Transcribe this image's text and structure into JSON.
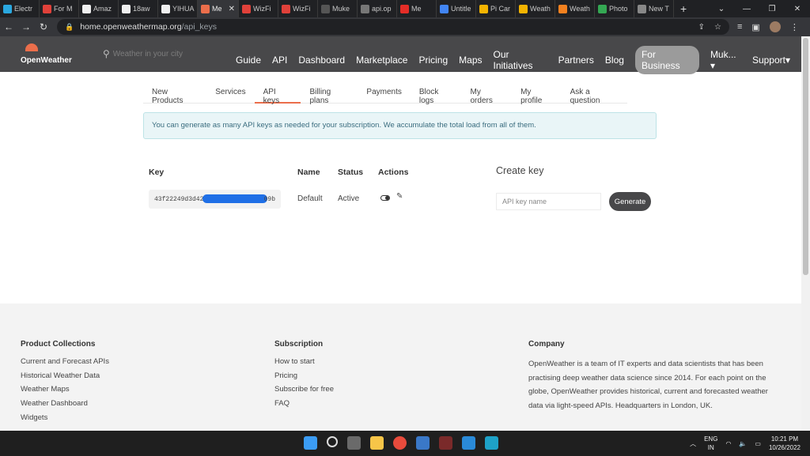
{
  "browser": {
    "tabs": [
      {
        "label": "Electr",
        "color": "#2aa8e0"
      },
      {
        "label": "For M",
        "color": "#e0413a"
      },
      {
        "label": "Amaz",
        "color": "#f0f0f0"
      },
      {
        "label": "18aw",
        "color": "#f0f0f0"
      },
      {
        "label": "YIHUA",
        "color": "#f0f0f0"
      },
      {
        "label": "Me",
        "color": "#eb6e4b",
        "active": true
      },
      {
        "label": "WizFi",
        "color": "#e0413a"
      },
      {
        "label": "WizFi",
        "color": "#e0413a"
      },
      {
        "label": "Muke",
        "color": "#555555"
      },
      {
        "label": "api.op",
        "color": "#777777"
      },
      {
        "label": "Me",
        "color": "#e52d27"
      },
      {
        "label": "Untitle",
        "color": "#4285f4"
      },
      {
        "label": "Pi Car",
        "color": "#f4b400"
      },
      {
        "label": "Weath",
        "color": "#f4b400"
      },
      {
        "label": "Weath",
        "color": "#f4811f"
      },
      {
        "label": "Photo",
        "color": "#34a853"
      },
      {
        "label": "New T",
        "color": "#888888"
      }
    ],
    "url_host": "home.openweathermap.org",
    "url_path": "/api_keys"
  },
  "site": {
    "logo_text": "OpenWeather",
    "search_placeholder": "Weather in your city",
    "nav": [
      "Guide",
      "API",
      "Dashboard",
      "Marketplace",
      "Pricing",
      "Maps",
      "Our Initiatives",
      "Partners",
      "Blog"
    ],
    "business_label": "For Business",
    "user_label": "Muk... ▾",
    "support_label": "Support▾"
  },
  "subnav": {
    "items": [
      "New Products",
      "Services",
      "API keys",
      "Billing plans",
      "Payments",
      "Block logs",
      "My orders",
      "My profile",
      "Ask a question"
    ],
    "active": "API keys"
  },
  "banner_text": "You can generate as many API keys as needed for your subscription. We accumulate the total load from all of them.",
  "keys_table": {
    "headers": {
      "key": "Key",
      "name": "Name",
      "status": "Status",
      "actions": "Actions"
    },
    "rows": [
      {
        "key_prefix": "43f22249d3d42",
        "key_suffix": "09b",
        "name": "Default",
        "status": "Active"
      }
    ]
  },
  "create_key": {
    "title": "Create key",
    "placeholder": "API key name",
    "button": "Generate"
  },
  "footer": {
    "product_collections": {
      "title": "Product Collections",
      "links": [
        "Current and Forecast APIs",
        "Historical Weather Data",
        "Weather Maps",
        "Weather Dashboard",
        "Widgets"
      ]
    },
    "subscription": {
      "title": "Subscription",
      "links": [
        "How to start",
        "Pricing",
        "Subscribe for free",
        "FAQ"
      ]
    },
    "company": {
      "title": "Company",
      "text": "OpenWeather is a team of IT experts and data scientists that has been practising deep weather data science since 2014. For each point on the globe, OpenWeather provides historical, current and forecasted weather data via light-speed APIs. Headquarters in London, UK."
    }
  },
  "taskbar": {
    "language_top": "ENG",
    "language_bottom": "IN",
    "time": "10:21 PM",
    "date": "10/26/2022"
  }
}
